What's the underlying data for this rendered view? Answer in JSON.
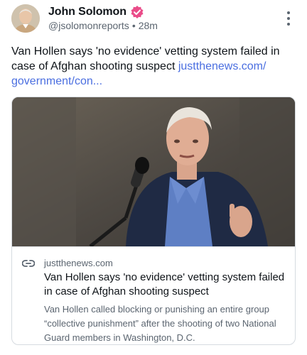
{
  "post": {
    "author": {
      "name": "John Solomon",
      "handle": "@jsolomonreports",
      "time": "28m",
      "separator": "•",
      "verified_color": "#ea4c89"
    },
    "text": "Van Hollen says 'no evidence' vetting system failed in case of Afghan shooting suspect",
    "link_text": "justthenews.com/​government/con..."
  },
  "card": {
    "image_description": "man speaking at a microphone",
    "domain": "justthenews.com",
    "title": "Van Hollen says 'no evidence' vetting system failed in case of Afghan shooting suspect",
    "description": "Van Hollen called blocking or punishing an entire group “collective punishment” after the shooting of two National Guard members in Washington, D.C."
  },
  "colors": {
    "link": "#4a6ee0",
    "secondary_text": "#5b6570",
    "border": "#d6dbe0"
  }
}
